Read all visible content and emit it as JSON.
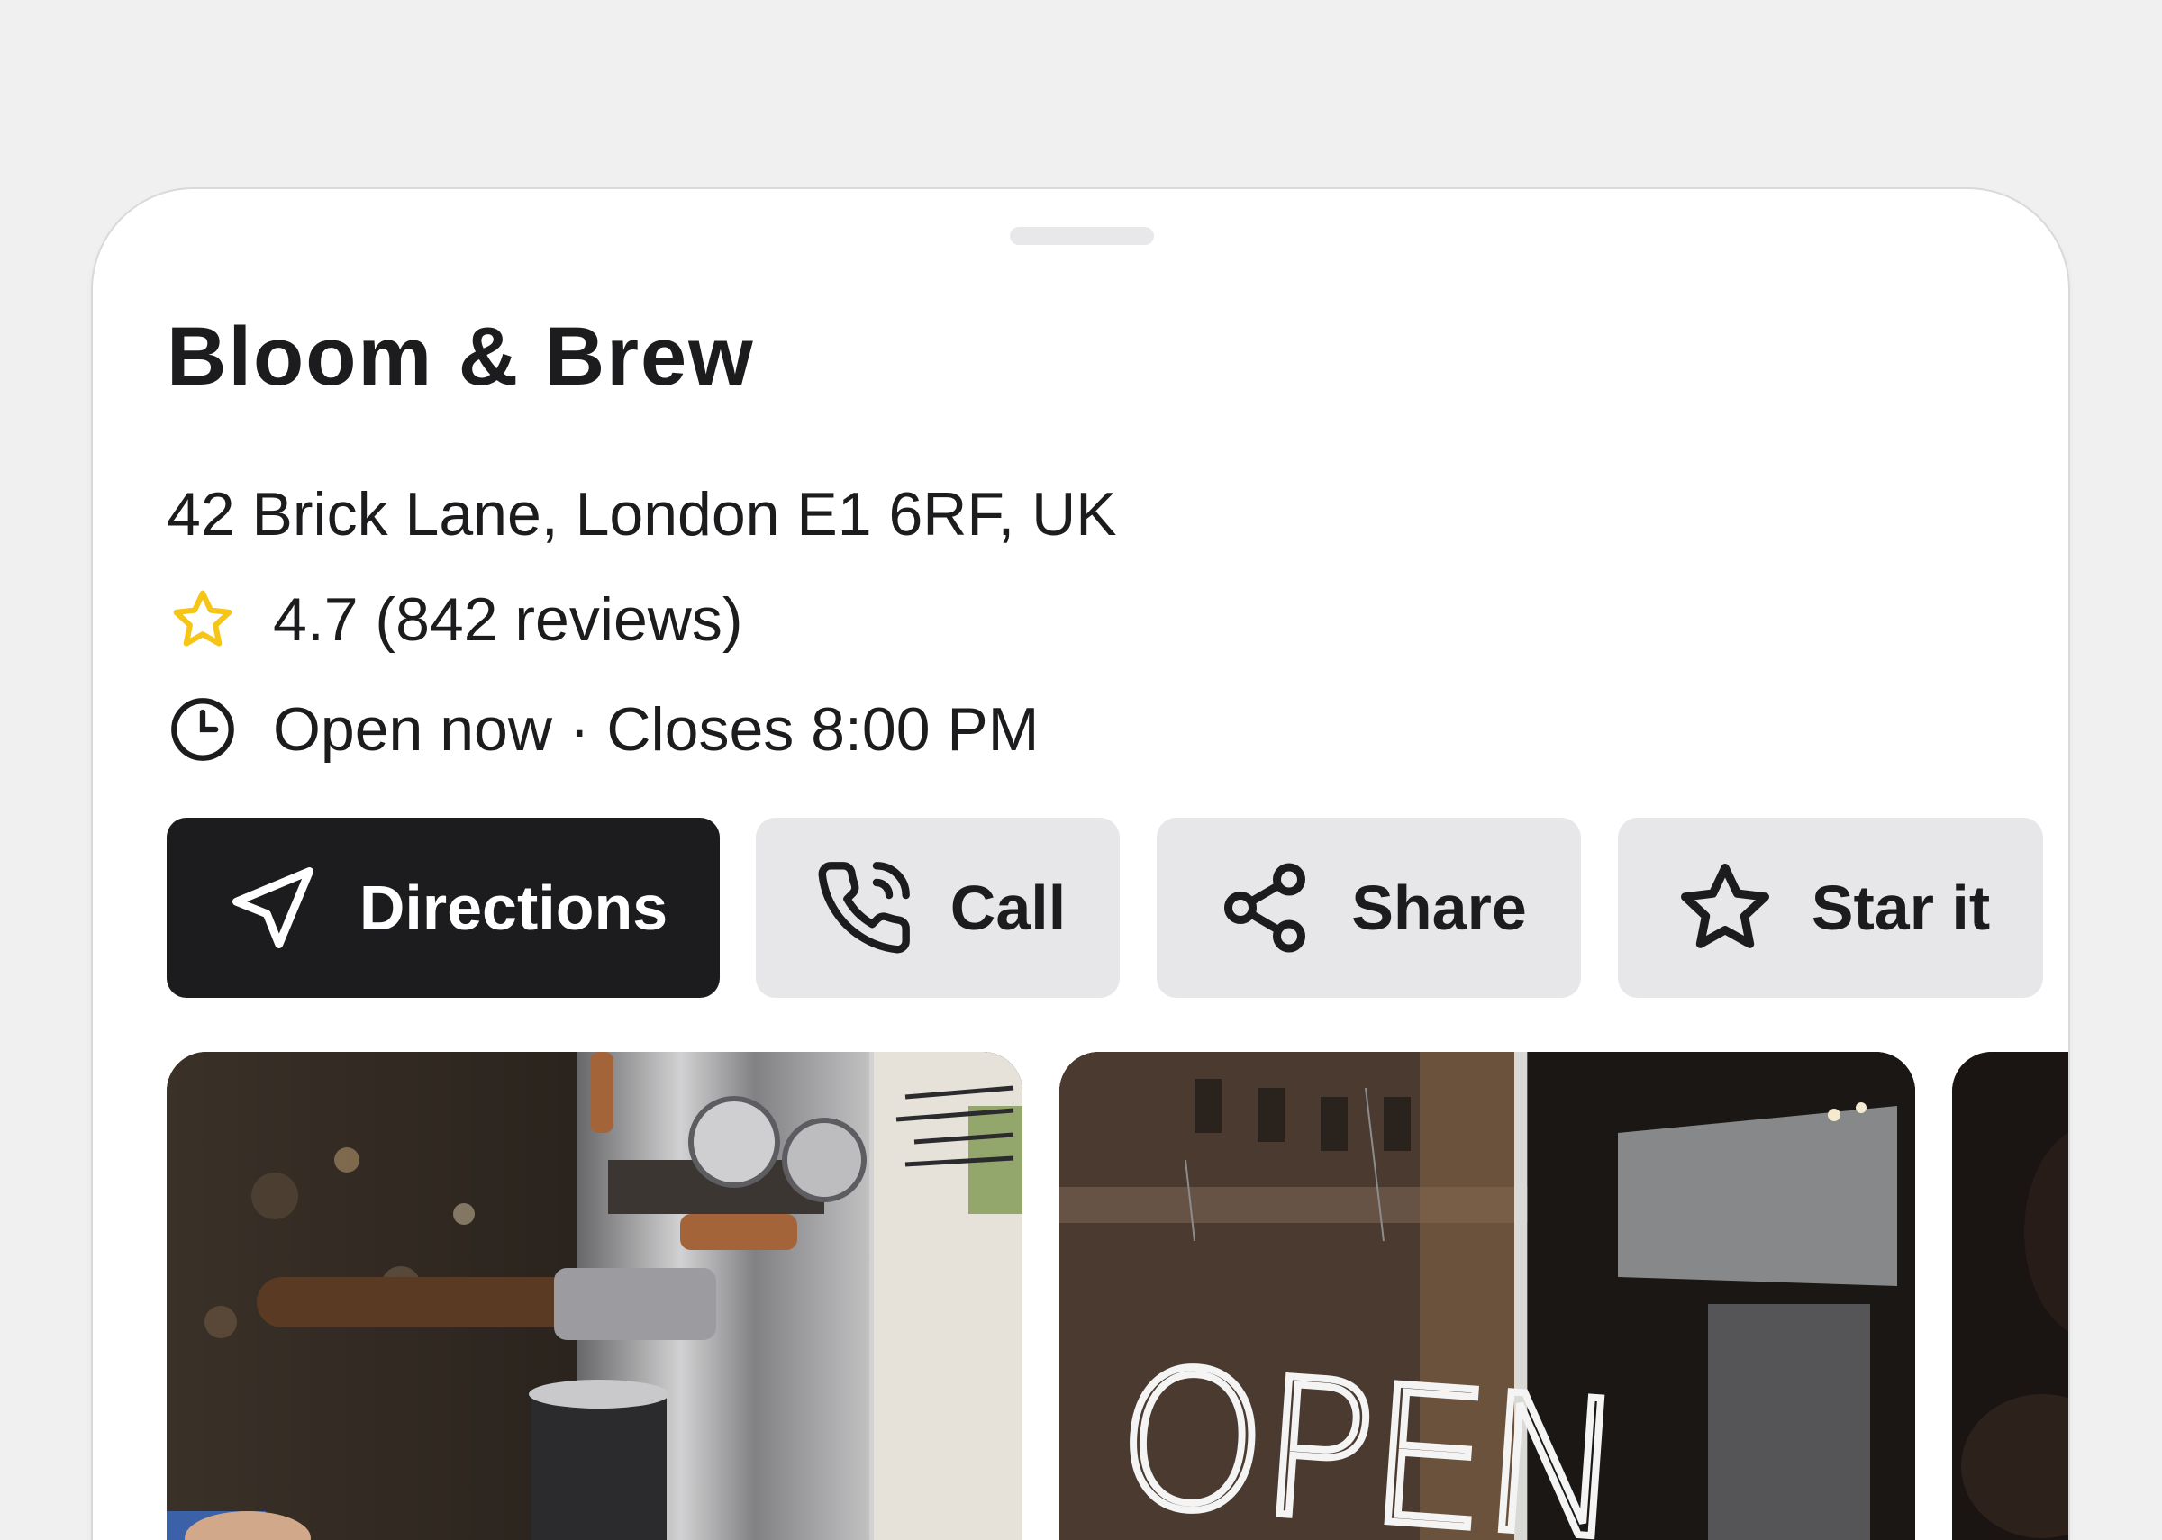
{
  "place": {
    "name": "Bloom & Brew",
    "address": "42 Brick Lane, London E1 6RF, UK",
    "rating_text": "4.7 (842 reviews)",
    "hours_text": "Open now · Closes 8:00 PM"
  },
  "actions": {
    "directions": "Directions",
    "call": "Call",
    "share": "Share",
    "star": "Star it"
  },
  "photos": {
    "sign_text": "OPEN"
  },
  "colors": {
    "primary_button": "#1c1c1e",
    "secondary_button": "#e7e7ea",
    "star_accent": "#f5c518"
  },
  "icons": {
    "rating": "star-outline-icon",
    "hours": "clock-icon",
    "directions": "navigation-arrow-icon",
    "call": "phone-icon",
    "share": "share-icon",
    "star": "star-outline-icon"
  }
}
